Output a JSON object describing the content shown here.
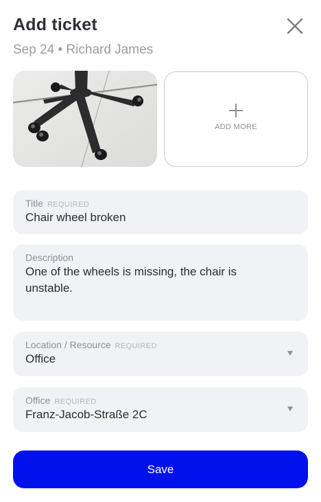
{
  "header": {
    "title": "Add ticket",
    "subtitle": "Sep 24 • Richard James"
  },
  "icons": {
    "close": "close-icon",
    "add": "plus-icon",
    "dropdown": "caret-down-icon"
  },
  "attachments": {
    "add_more_label": "ADD MORE"
  },
  "form": {
    "title": {
      "label": "Title",
      "required": "REQUIRED",
      "value": "Chair wheel broken"
    },
    "description": {
      "label": "Description",
      "value": "One of the wheels is missing, the chair is unstable."
    },
    "location": {
      "label": "Location / Resource",
      "required": "REQUIRED",
      "value": "Office"
    },
    "office": {
      "label": "Office",
      "required": "REQUIRED",
      "value": "Franz-Jacob-Straße 2C"
    }
  },
  "actions": {
    "save_label": "Save"
  },
  "colors": {
    "primary": "#0011ee",
    "field_bg": "#f0f2f5",
    "muted_text": "#9a9ca3"
  }
}
